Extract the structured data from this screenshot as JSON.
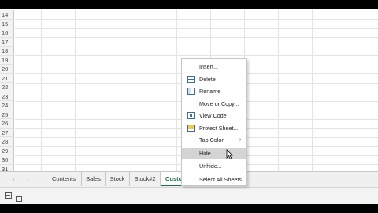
{
  "rows": [
    "14",
    "15",
    "16",
    "17",
    "18",
    "19",
    "20",
    "21",
    "22",
    "23",
    "24",
    "25",
    "26",
    "27",
    "28",
    "29",
    "30",
    "31"
  ],
  "tabs": {
    "items": [
      "Contents",
      "Sales",
      "Stock",
      "Stock#2",
      "Customers"
    ],
    "active": "Customers",
    "nav_prev": "‹",
    "nav_next": "›",
    "add_symbol": "+"
  },
  "context_menu": {
    "items": [
      {
        "label": "Insert...",
        "icon": "none"
      },
      {
        "label": "Delete",
        "icon": "delete-sheet-icon"
      },
      {
        "label": "Rename",
        "icon": "rename-sheet-icon"
      },
      {
        "label": "Move or Copy...",
        "icon": "none"
      },
      {
        "label": "View Code",
        "icon": "view-code-icon"
      },
      {
        "label": "Protect Sheet...",
        "icon": "protect-sheet-icon"
      },
      {
        "label": "Tab Color",
        "icon": "none",
        "submenu_arrow": "›"
      },
      {
        "label": "Hide",
        "icon": "none",
        "hovered": true
      },
      {
        "label": "Unhide...",
        "icon": "none"
      },
      {
        "label": "Select All Sheets",
        "icon": "none"
      }
    ]
  },
  "colors": {
    "active_tab": "#1e7145",
    "menu_hover": "#d4d4d4",
    "icon_blue": "#3c6e99"
  }
}
